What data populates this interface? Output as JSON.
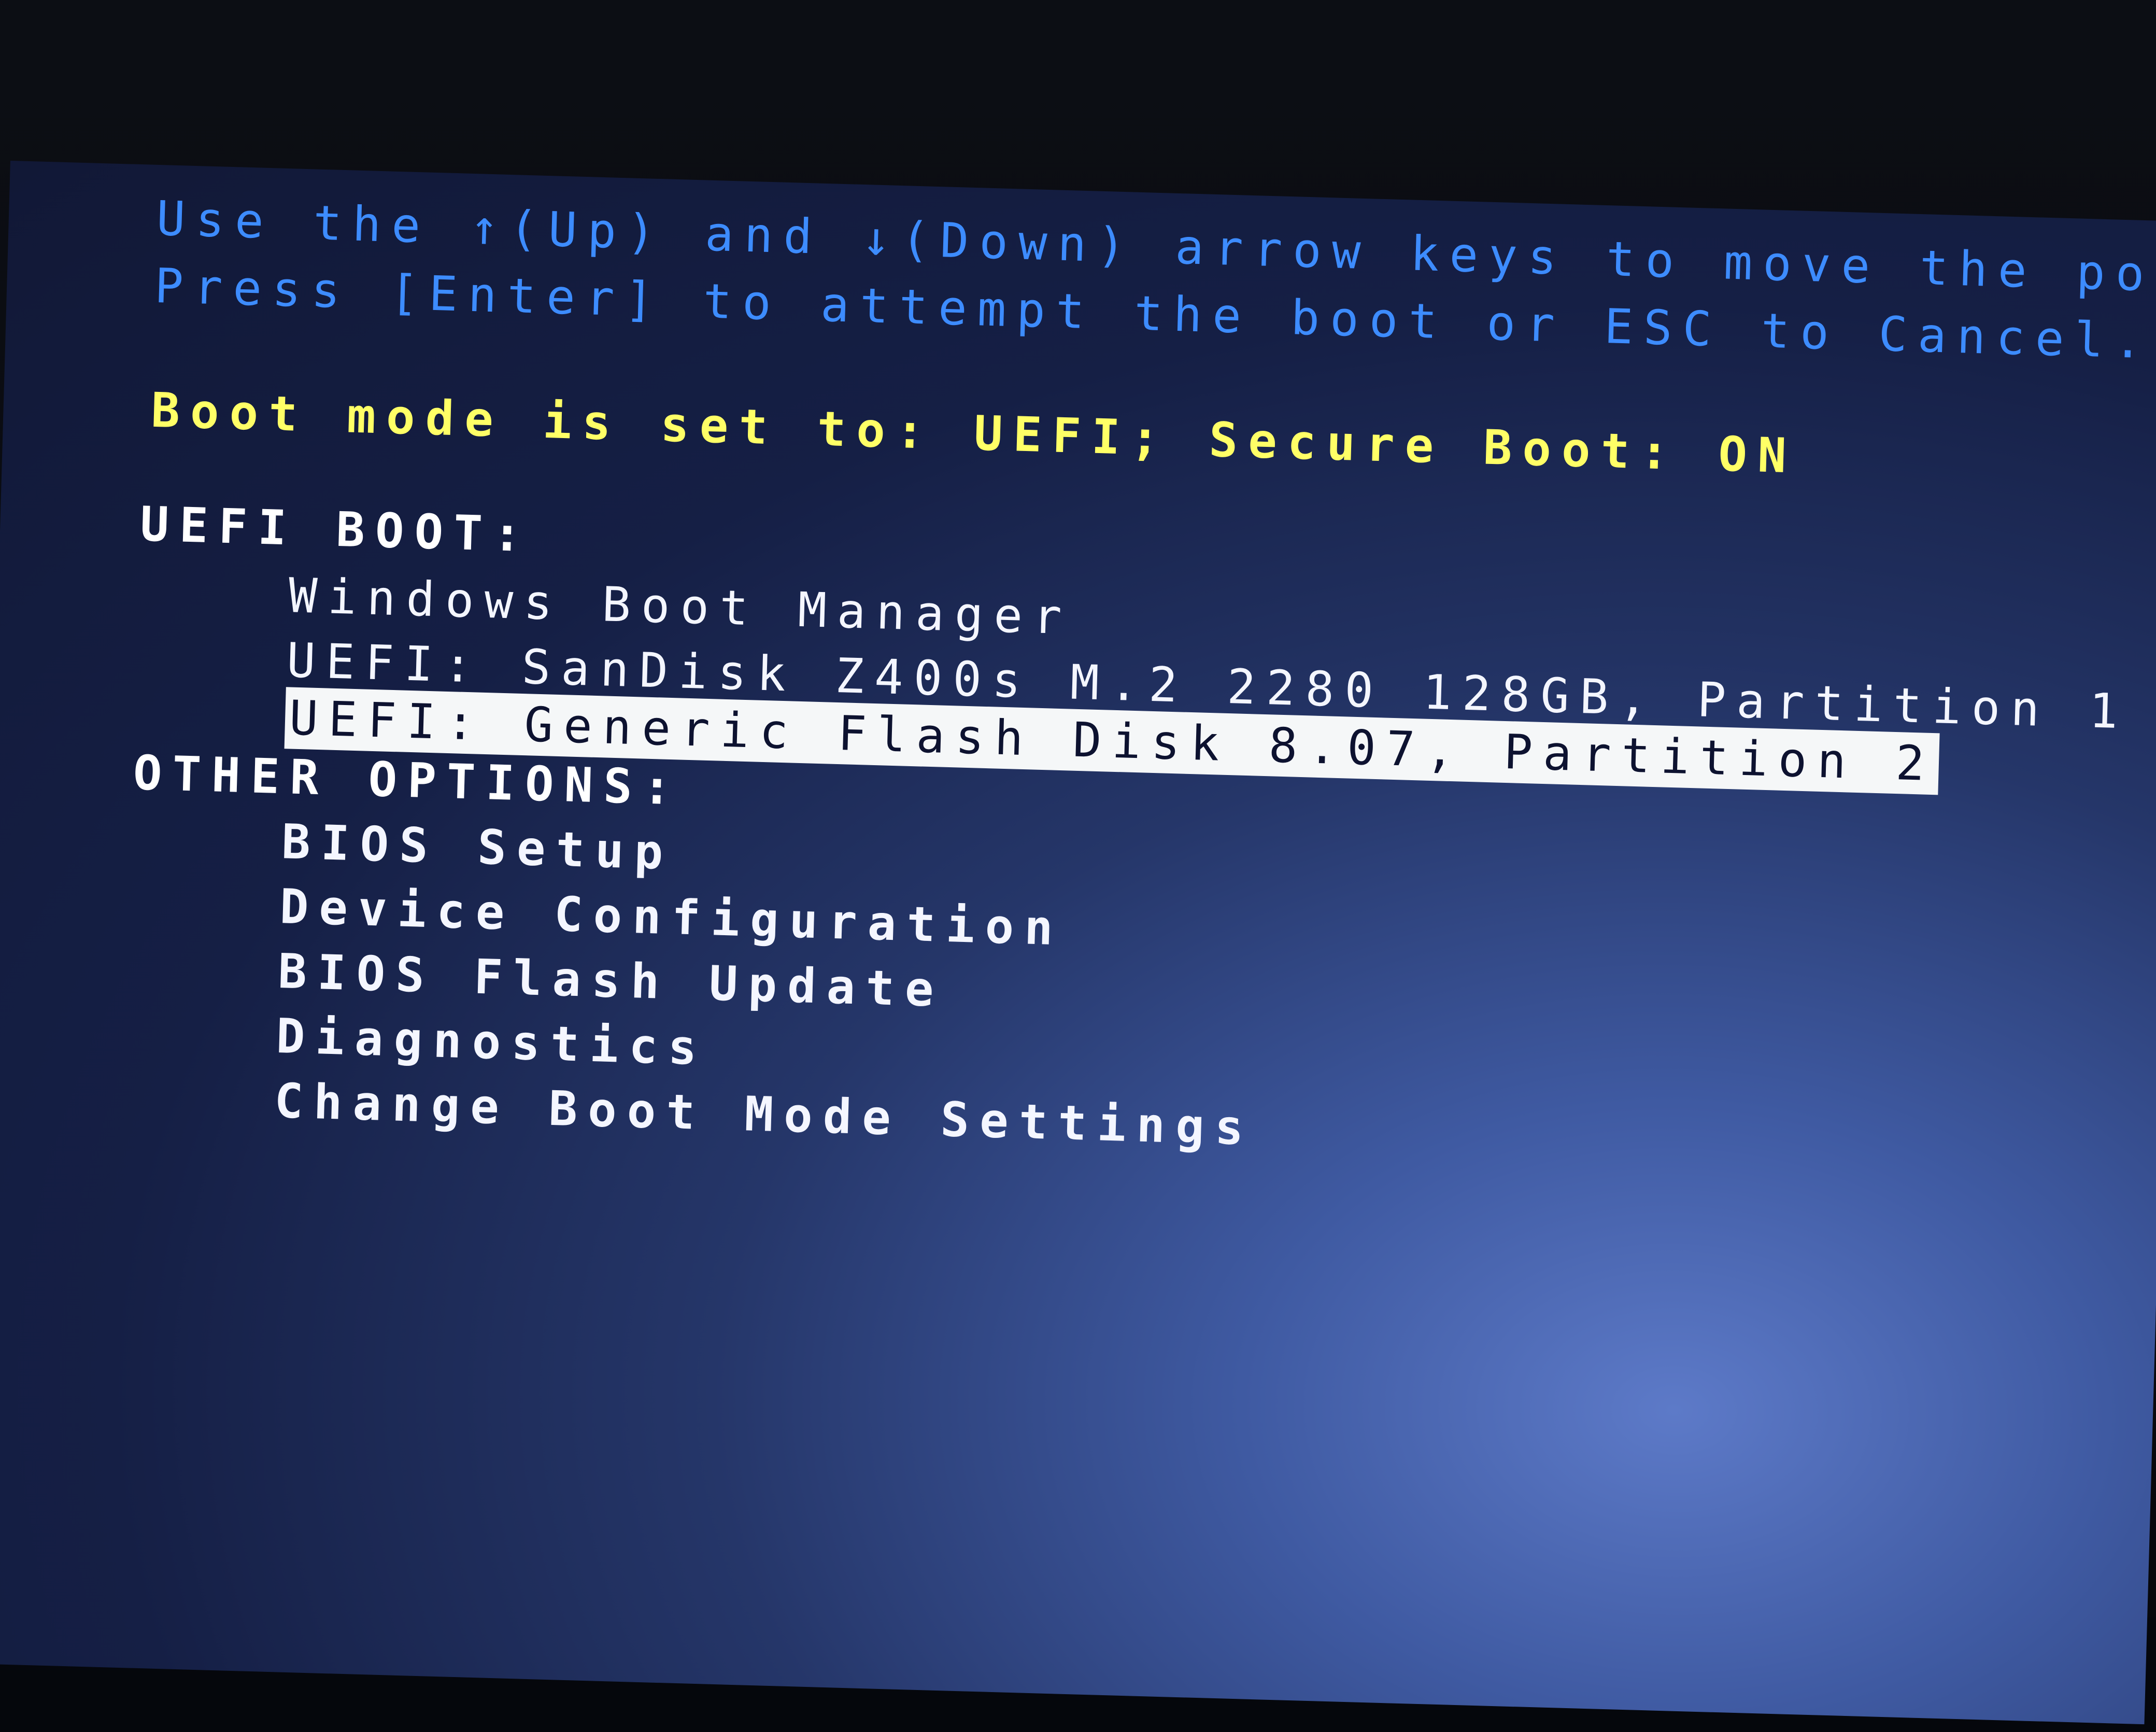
{
  "instructions": {
    "line1": "Use the ↑(Up) and ↓(Down) arrow keys to move the pointer to",
    "line2": "Press [Enter] to attempt the boot or ESC to Cancel. (* = Pa"
  },
  "boot_mode": "Boot mode is set to: UEFI; Secure Boot: ON",
  "sections": [
    {
      "heading": "UEFI BOOT:",
      "items": [
        {
          "label": "Windows Boot Manager",
          "selected": false
        },
        {
          "label": "UEFI: SanDisk Z400s M.2 2280 128GB, Partition 1",
          "selected": false
        },
        {
          "label": "UEFI: Generic Flash Disk 8.07, Partition 2",
          "selected": true
        }
      ]
    },
    {
      "heading": "OTHER OPTIONS:",
      "items": [
        {
          "label": "BIOS Setup",
          "selected": false
        },
        {
          "label": "Device Configuration",
          "selected": false
        },
        {
          "label": "BIOS Flash Update",
          "selected": false
        },
        {
          "label": "Diagnostics",
          "selected": false
        },
        {
          "label": "Change Boot Mode Settings",
          "selected": false
        }
      ]
    }
  ],
  "colors": {
    "hint_text": "#3d8cff",
    "boot_mode_text": "#ffff66",
    "menu_text": "#f4f6ff",
    "selection_bg": "#f5f7f8",
    "screen_bg": "#151f45"
  }
}
